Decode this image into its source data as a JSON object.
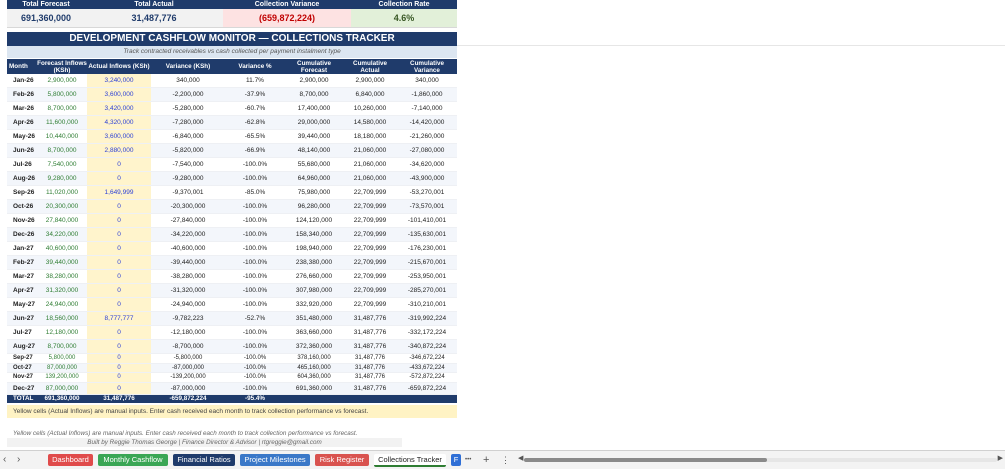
{
  "kpis": [
    {
      "label": "Total Forecast",
      "value": "691,360,000",
      "bg": "#f2f2f2",
      "color": "#1f3b6b"
    },
    {
      "label": "Total Actual",
      "value": "31,487,776",
      "bg": "#f2f2f2",
      "color": "#1f3b6b"
    },
    {
      "label": "Collection Variance",
      "value": "(659,872,224)",
      "bg": "#fde2e2",
      "color": "#c00000"
    },
    {
      "label": "Collection Rate",
      "value": "4.6%",
      "bg": "#e2f0d9",
      "color": "#375623"
    }
  ],
  "banner": "DEVELOPMENT CASHFLOW MONITOR — COLLECTIONS TRACKER",
  "subtitle": "Track contracted receivables vs cash collected per payment instalment type",
  "columns": [
    "Month",
    "Forecast Inflows (KSh)",
    "Actual Inflows (KSh)",
    "Variance (KSh)",
    "Variance %",
    "Cumulative Forecast",
    "Cumulative Actual",
    "Cumulative Variance"
  ],
  "rows": [
    [
      "Jan-26",
      "2,900,000",
      "3,240,000",
      "340,000",
      "11.7%",
      "2,900,000",
      "2,900,000",
      "340,000"
    ],
    [
      "Feb-26",
      "5,800,000",
      "3,600,000",
      "-2,200,000",
      "-37.9%",
      "8,700,000",
      "6,840,000",
      "-1,860,000"
    ],
    [
      "Mar-26",
      "8,700,000",
      "3,420,000",
      "-5,280,000",
      "-60.7%",
      "17,400,000",
      "10,260,000",
      "-7,140,000"
    ],
    [
      "Apr-26",
      "11,600,000",
      "4,320,000",
      "-7,280,000",
      "-62.8%",
      "29,000,000",
      "14,580,000",
      "-14,420,000"
    ],
    [
      "May-26",
      "10,440,000",
      "3,600,000",
      "-6,840,000",
      "-65.5%",
      "39,440,000",
      "18,180,000",
      "-21,260,000"
    ],
    [
      "Jun-26",
      "8,700,000",
      "2,880,000",
      "-5,820,000",
      "-66.9%",
      "48,140,000",
      "21,060,000",
      "-27,080,000"
    ],
    [
      "Jul-26",
      "7,540,000",
      "0",
      "-7,540,000",
      "-100.0%",
      "55,680,000",
      "21,060,000",
      "-34,620,000"
    ],
    [
      "Aug-26",
      "9,280,000",
      "0",
      "-9,280,000",
      "-100.0%",
      "64,960,000",
      "21,060,000",
      "-43,900,000"
    ],
    [
      "Sep-26",
      "11,020,000",
      "1,649,999",
      "-9,370,001",
      "-85.0%",
      "75,980,000",
      "22,709,999",
      "-53,270,001"
    ],
    [
      "Oct-26",
      "20,300,000",
      "0",
      "-20,300,000",
      "-100.0%",
      "96,280,000",
      "22,709,999",
      "-73,570,001"
    ],
    [
      "Nov-26",
      "27,840,000",
      "0",
      "-27,840,000",
      "-100.0%",
      "124,120,000",
      "22,709,999",
      "-101,410,001"
    ],
    [
      "Dec-26",
      "34,220,000",
      "0",
      "-34,220,000",
      "-100.0%",
      "158,340,000",
      "22,709,999",
      "-135,630,001"
    ],
    [
      "Jan-27",
      "40,600,000",
      "0",
      "-40,600,000",
      "-100.0%",
      "198,940,000",
      "22,709,999",
      "-176,230,001"
    ],
    [
      "Feb-27",
      "39,440,000",
      "0",
      "-39,440,000",
      "-100.0%",
      "238,380,000",
      "22,709,999",
      "-215,670,001"
    ],
    [
      "Mar-27",
      "38,280,000",
      "0",
      "-38,280,000",
      "-100.0%",
      "276,660,000",
      "22,709,999",
      "-253,950,001"
    ],
    [
      "Apr-27",
      "31,320,000",
      "0",
      "-31,320,000",
      "-100.0%",
      "307,980,000",
      "22,709,999",
      "-285,270,001"
    ],
    [
      "May-27",
      "24,940,000",
      "0",
      "-24,940,000",
      "-100.0%",
      "332,920,000",
      "22,709,999",
      "-310,210,001"
    ],
    [
      "Jun-27",
      "18,560,000",
      "8,777,777",
      "-9,782,223",
      "-52.7%",
      "351,480,000",
      "31,487,776",
      "-319,992,224"
    ],
    [
      "Jul-27",
      "12,180,000",
      "0",
      "-12,180,000",
      "-100.0%",
      "363,660,000",
      "31,487,776",
      "-332,172,224"
    ],
    [
      "Aug-27",
      "8,700,000",
      "0",
      "-8,700,000",
      "-100.0%",
      "372,360,000",
      "31,487,776",
      "-340,872,224"
    ],
    [
      "Sep-27",
      "5,800,000",
      "0",
      "-5,800,000",
      "-100.0%",
      "378,160,000",
      "31,487,776",
      "-346,672,224"
    ],
    [
      "Oct-27",
      "87,000,000",
      "0",
      "-87,000,000",
      "-100.0%",
      "465,160,000",
      "31,487,776",
      "-433,672,224"
    ],
    [
      "Nov-27",
      "139,200,000",
      "0",
      "-139,200,000",
      "-100.0%",
      "604,360,000",
      "31,487,776",
      "-572,872,224"
    ],
    [
      "Dec-27",
      "87,000,000",
      "0",
      "-87,000,000",
      "-100.0%",
      "691,360,000",
      "31,487,776",
      "-659,872,224"
    ]
  ],
  "total_row": [
    "TOTAL",
    "691,360,000",
    "31,487,776",
    "-659,872,224",
    "-95.4%",
    "",
    "",
    ""
  ],
  "note_primary": "Yellow cells (Actual Inflows) are manual inputs. Enter cash received each month to track collection performance vs forecast.",
  "note_secondary": "Yellow cells (Actual Inflows) are manual inputs. Enter cash received each month to track collection performance vs forecast.",
  "credit": "Built by Reggie Thomas George  |  Finance Director & Advisor  |  rtgreggie@gmail.com",
  "sheet_tabs": [
    {
      "label": "Dashboard",
      "color": "#e04b4b",
      "active": false
    },
    {
      "label": "Monthly Cashflow",
      "color": "#3aa655",
      "active": false
    },
    {
      "label": "Financial Ratios",
      "color": "#1f3b6b",
      "active": false
    },
    {
      "label": "Project Milestones",
      "color": "#3a78c8",
      "active": false
    },
    {
      "label": "Risk Register",
      "color": "#d9534f",
      "active": false
    },
    {
      "label": "Collections Tracker",
      "color": "#ffffff",
      "active": true
    },
    {
      "label": "F",
      "color": "#2f6fd6",
      "active": false
    }
  ],
  "tab_bar": {
    "prev": "‹",
    "next": "›",
    "more": "•••",
    "add": "+",
    "options": "⋮"
  },
  "scrollbar": {
    "left_arrow": "◀",
    "right_arrow": "▶"
  }
}
